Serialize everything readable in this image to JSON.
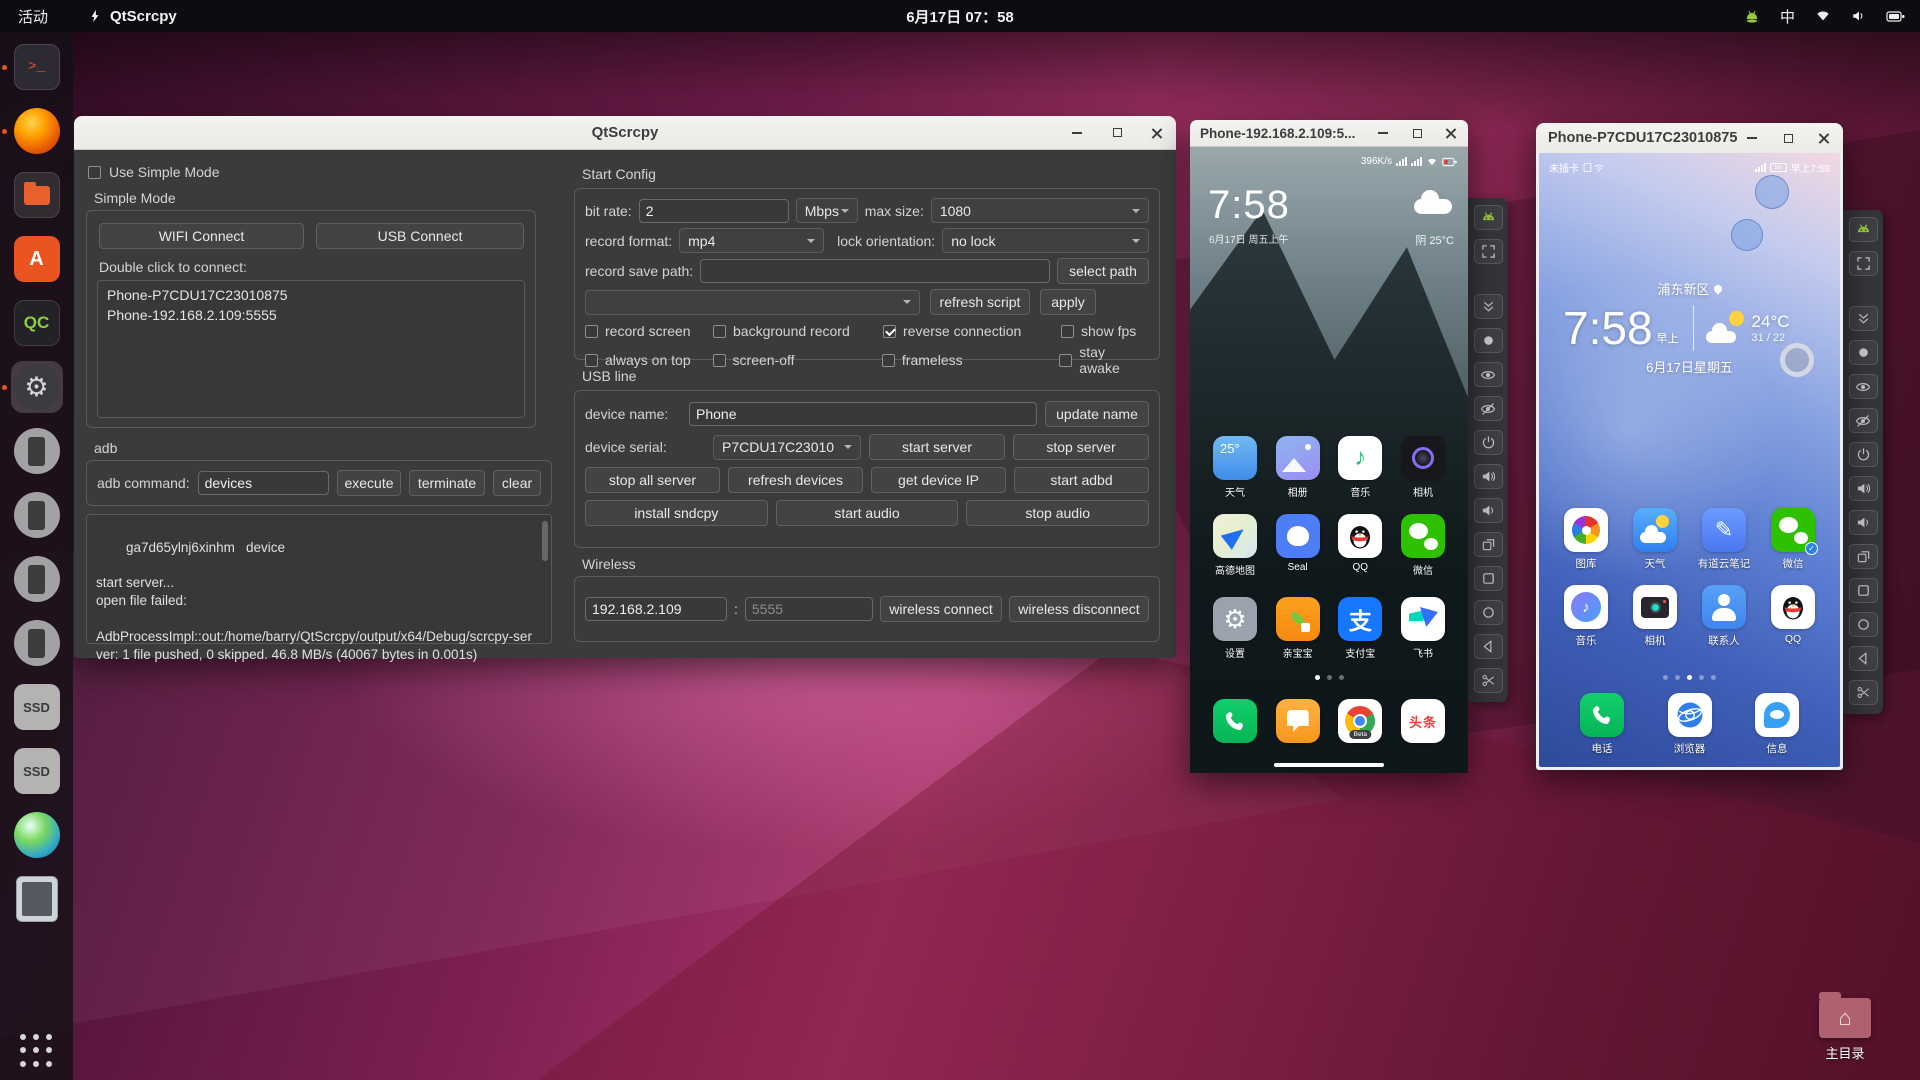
{
  "topbar": {
    "activities": "活动",
    "app_name": "QtScrcpy",
    "clock": "6月17日 07：58",
    "ime": "中"
  },
  "glyphs": {
    "gear": "⚙",
    "note": "♪",
    "pencil": "✎",
    "house": "⌂",
    "terminal_prompt": ">_"
  },
  "dock": {
    "qc_label": "QC",
    "ssd_label": "SSD"
  },
  "main_window": {
    "title": "QtScrcpy",
    "left": {
      "use_simple_mode": "Use Simple Mode",
      "simple_mode": "Simple Mode",
      "wifi_connect": "WIFI Connect",
      "usb_connect": "USB Connect",
      "double_click": "Double click to connect:",
      "devices": [
        "Phone-P7CDU17C23010875",
        "Phone-192.168.2.109:5555"
      ],
      "adb_label": "adb",
      "adb_command": "adb command:",
      "adb_value": "devices",
      "execute": "execute",
      "terminate": "terminate",
      "clear": "clear",
      "log": "ga7d65ylnj6xinhm\tdevice\n\nstart server...\nopen file failed:\n\nAdbProcessImpl::out:/home/barry/QtScrcpy/output/x64/Debug/scrcpy-server: 1 file pushed, 0 skipped. 46.8 MB/s (40067 bytes in 0.001s)"
    },
    "config": {
      "title": "Start Config",
      "bit_rate": "bit rate:",
      "bit_rate_value": "2",
      "unit": "Mbps",
      "max_size": "max size:",
      "max_size_value": "1080",
      "record_format": "record format:",
      "record_format_value": "mp4",
      "lock_orientation": "lock orientation:",
      "lock_orientation_value": "no lock",
      "record_save_path": "record save path:",
      "select_path": "select path",
      "refresh_script": "refresh script",
      "apply": "apply",
      "checks_row1": [
        "record screen",
        "background record",
        "reverse connection",
        "show fps"
      ],
      "checks_row2": [
        "always on top",
        "screen-off",
        "frameless",
        "stay awake"
      ],
      "checked": "reverse connection"
    },
    "usb": {
      "title": "USB line",
      "device_name": "device name:",
      "device_name_value": "Phone",
      "update_name": "update name",
      "device_serial": "device serial:",
      "device_serial_value": "P7CDU17C23010",
      "start_server": "start server",
      "stop_server": "stop server",
      "stop_all_server": "stop all server",
      "refresh_devices": "refresh devices",
      "get_device_ip": "get device IP",
      "start_adbd": "start adbd",
      "install_sndcpy": "install sndcpy",
      "start_audio": "start audio",
      "stop_audio": "stop audio"
    },
    "wireless": {
      "title": "Wireless",
      "ip": "192.168.2.109",
      "colon": ":",
      "port_placeholder": "5555",
      "connect": "wireless connect",
      "disconnect": "wireless disconnect"
    }
  },
  "toolbar": {
    "buttons": [
      "group-control",
      "fullscreen",
      "expand-notification",
      "touch",
      "screen-on",
      "screen-off",
      "power",
      "volume-up",
      "volume-down",
      "app-switch",
      "menu",
      "home",
      "back",
      "screenshot"
    ]
  },
  "phone1": {
    "title": "Phone-192.168.2.109:5...",
    "net_speed": "396K/s",
    "clock": "7:58",
    "date": "6月17日 周五上午",
    "weather": "阴  25°C",
    "apps": [
      {
        "label": "天气",
        "badge": "25°"
      },
      {
        "label": "相册"
      },
      {
        "label": "音乐"
      },
      {
        "label": "相机"
      },
      {
        "label": "高德地图"
      },
      {
        "label": "Seal"
      },
      {
        "label": "QQ"
      },
      {
        "label": "微信"
      },
      {
        "label": "设置"
      },
      {
        "label": "亲宝宝"
      },
      {
        "label": "支付宝",
        "glyph": "支"
      },
      {
        "label": "飞书"
      }
    ],
    "dock": [
      {
        "name": "phone"
      },
      {
        "name": "messages"
      },
      {
        "name": "chrome",
        "badge": "Beta"
      },
      {
        "name": "toutiao",
        "glyph": "头条"
      }
    ]
  },
  "phone2": {
    "title": "Phone-P7CDU17C23010875",
    "status_left": "未插卡",
    "status_time": "早上7:58",
    "location": "浦东新区",
    "clock": "7:58",
    "clock_suffix": "早上",
    "temp": "24°C",
    "range": "31 / 22",
    "date": "6月17日星期五",
    "apps": [
      {
        "label": "图库"
      },
      {
        "label": "天气"
      },
      {
        "label": "有道云笔记"
      },
      {
        "label": "微信"
      },
      {
        "label": "音乐"
      },
      {
        "label": "相机"
      },
      {
        "label": "联系人"
      },
      {
        "label": "QQ"
      }
    ],
    "dock": [
      {
        "label": "电话"
      },
      {
        "label": "浏览器"
      },
      {
        "label": "信息"
      }
    ]
  },
  "desktop": {
    "home_label": "主目录"
  }
}
